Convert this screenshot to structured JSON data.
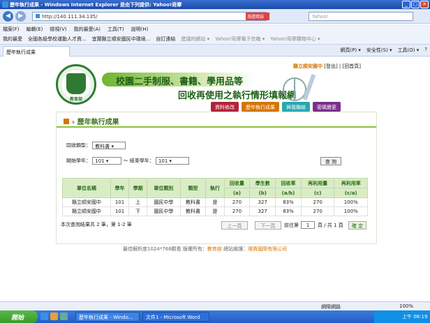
{
  "window": {
    "title": "歷年執行成果 - Windows Internet Explorer 是由下列提供: Yahoo!奇摩",
    "min": "_",
    "max": "□",
    "close": "✕"
  },
  "address": {
    "url": "http://140.111.34.135/",
    "cert": "憑證錯誤",
    "search_placeholder": "Yahoo!"
  },
  "menu": [
    "檔案(F)",
    "編輯(E)",
    "檢視(V)",
    "我的最愛(A)",
    "工具(T)",
    "說明(H)"
  ],
  "favorites": [
    "我的最愛",
    "全國各級學校運動人才資...",
    "宜蘭縣立順安國民中環境...",
    "自訂連結",
    "建議的網站 ▾",
    "Yahoo!奇摩電子信箱 ▾",
    "Yahoo!奇摩購物中心 ▾"
  ],
  "tab": {
    "label": "歷年執行成果"
  },
  "tab_tools": [
    "網頁(P) ▾",
    "安全性(S) ▾",
    "工具(O) ▾",
    "?"
  ],
  "site": {
    "school": "縣立順安國中",
    "links": "[登出] | [回首頁]",
    "logo_text": "教育部",
    "banner_line1": "校園二手制服、書籍、學用品等",
    "banner_line2": "回收再使用之執行情形填報網"
  },
  "nav_tabs": [
    {
      "label": "資料修改",
      "color": "#b0243a"
    },
    {
      "label": "歷年執行成果",
      "color": "#d47600"
    },
    {
      "label": "與我聯絡",
      "color": "#2aa7b0"
    },
    {
      "label": "密碼變更",
      "color": "#7a2f8a"
    }
  ],
  "content": {
    "title": "歷年執行成果",
    "type_label": "回收類型：",
    "type_value": "教科書",
    "start_label": "開始學年：",
    "start_value": "101",
    "sep": "～ 結束學年：",
    "end_value": "101",
    "query_btn": "查 詢"
  },
  "table": {
    "headers": [
      "單位名稱",
      "學年",
      "學期",
      "單位類別",
      "類型",
      "執行",
      "回收量",
      "學生數",
      "回收率",
      "再利用量",
      "再利用率"
    ],
    "subheaders": [
      "(a)",
      "(b)",
      "(a/b)",
      "(c)",
      "(c/a)"
    ],
    "rows": [
      [
        "縣立順安國中",
        "101",
        "上",
        "國民中學",
        "教科書",
        "是",
        "270",
        "327",
        "83%",
        "270",
        "100%"
      ],
      [
        "縣立順安國中",
        "101",
        "下",
        "國民中學",
        "教科書",
        "是",
        "270",
        "327",
        "83%",
        "270",
        "100%"
      ]
    ]
  },
  "pager": {
    "summary": "本次查詢結果共 2 筆，第 1-2 筆",
    "prev": "上一頁",
    "next": "下一頁",
    "goto": "前往第",
    "page": "1",
    "total": "頁 / 共 1 頁",
    "confirm": "確 定"
  },
  "footer": {
    "text1": "最佳解析度1024*768觀看 版權所有：",
    "owner": "教育部",
    "text2": " 網站維護：",
    "maint": "環資國際有限公司"
  },
  "status": {
    "zone": "網際網路",
    "zoom": "100%"
  },
  "taskbar": {
    "start": "開始",
    "items": [
      "歷年執行成果 - Windo...",
      "文件1 - Microsoft Word"
    ],
    "time": "上午 08:19"
  }
}
